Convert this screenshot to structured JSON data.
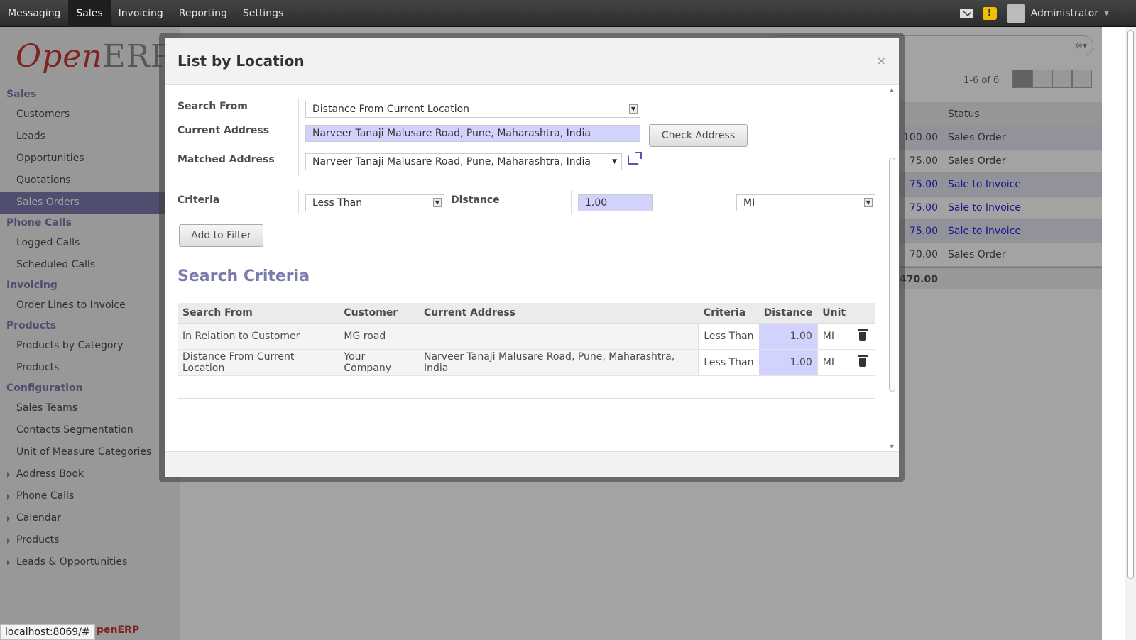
{
  "topbar": {
    "menu": [
      "Messaging",
      "Sales",
      "Invoicing",
      "Reporting",
      "Settings"
    ],
    "active": "Sales",
    "user": "Administrator",
    "icons": [
      "mail-icon",
      "warning-icon"
    ]
  },
  "sidebar": {
    "logo": {
      "open": "Open",
      "erp": "ERP"
    },
    "sections": [
      {
        "title": "Sales",
        "items": [
          "Customers",
          "Leads",
          "Opportunities",
          "Quotations",
          "Sales Orders"
        ]
      },
      {
        "title": "Phone Calls",
        "items": [
          "Logged Calls",
          "Scheduled Calls"
        ]
      },
      {
        "title": "Invoicing",
        "items": [
          "Order Lines to Invoice"
        ]
      },
      {
        "title": "Products",
        "items": [
          "Products by Category",
          "Products"
        ]
      },
      {
        "title": "Configuration",
        "items": [
          "Sales Teams",
          "Contacts Segmentation",
          "Unit of Measure Categories"
        ]
      }
    ],
    "tree_items": [
      "Address Book",
      "Phone Calls",
      "Calendar",
      "Products",
      "Leads & Opportunities"
    ],
    "active_item": "Sales Orders",
    "powered": "penERP"
  },
  "list": {
    "pager": "1-6 of 6",
    "status_header": "Status",
    "rows": [
      {
        "amount": "100.00",
        "status": "Sales Order",
        "blue": false
      },
      {
        "amount": "75.00",
        "status": "Sales Order",
        "blue": false
      },
      {
        "amount": "75.00",
        "status": "Sale to Invoice",
        "blue": true
      },
      {
        "amount": "75.00",
        "status": "Sale to Invoice",
        "blue": true
      },
      {
        "amount": "75.00",
        "status": "Sale to Invoice",
        "blue": true
      },
      {
        "amount": "70.00",
        "status": "Sales Order",
        "blue": false
      }
    ],
    "total": "470.00"
  },
  "dialog": {
    "title": "List by Location",
    "close": "×",
    "labels": {
      "search_from": "Search From",
      "current_address": "Current Address",
      "matched_address": "Matched Address",
      "criteria": "Criteria",
      "distance": "Distance"
    },
    "values": {
      "search_from": "Distance From Current Location",
      "current_address": "Narveer Tanaji Malusare Road, Pune, Maharashtra, India",
      "matched_address": "Narveer Tanaji Malusare Road, Pune, Maharashtra, India",
      "criteria": "Less Than",
      "distance": "1.00",
      "unit": "MI"
    },
    "buttons": {
      "check_address": "Check Address",
      "add_to_filter": "Add to Filter"
    },
    "criteria_title": "Search Criteria",
    "table": {
      "headers": [
        "Search From",
        "Customer",
        "Current Address",
        "Criteria",
        "Distance",
        "Unit"
      ],
      "rows": [
        [
          "In Relation to Customer",
          "MG road",
          "",
          "Less Than",
          "1.00",
          "MI"
        ],
        [
          "Distance From Current Location",
          "Your Company",
          "Narveer Tanaji Malusare Road, Pune, Maharashtra, India",
          "Less Than",
          "1.00",
          "MI"
        ]
      ]
    }
  },
  "statusbar": {
    "url": "localhost:8069/#"
  }
}
